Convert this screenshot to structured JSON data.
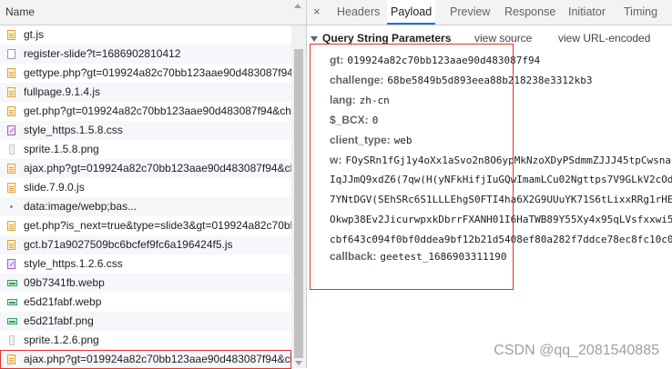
{
  "network": {
    "column_header": "Name",
    "rows": [
      {
        "name": "gt.js",
        "type": "js"
      },
      {
        "name": "register-slide?t=1686902810412",
        "type": "doc"
      },
      {
        "name": "gettype.php?gt=019924a82c70bb123aae90d483087f94&ca",
        "type": "js"
      },
      {
        "name": "fullpage.9.1.4.js",
        "type": "js"
      },
      {
        "name": "get.php?gt=019924a82c70bb123aae90d483087f94&challe",
        "type": "js"
      },
      {
        "name": "style_https.1.5.8.css",
        "type": "css"
      },
      {
        "name": "sprite.1.5.8.png",
        "type": "png"
      },
      {
        "name": "ajax.php?gt=019924a82c70bb123aae90d483087f94&chal",
        "type": "js"
      },
      {
        "name": "slide.7.9.0.js",
        "type": "js"
      },
      {
        "name": "data:image/webp;bas...",
        "type": "dot"
      },
      {
        "name": "get.php?is_next=true&type=slide3&gt=019924a82c70bb12",
        "type": "js"
      },
      {
        "name": "gct.b71a9027509bc6bcfef9fc6a196424f5.js",
        "type": "js"
      },
      {
        "name": "style_https.1.2.6.css",
        "type": "css"
      },
      {
        "name": "09b7341fb.webp",
        "type": "webp"
      },
      {
        "name": "e5d21fabf.webp",
        "type": "webp"
      },
      {
        "name": "e5d21fabf.png",
        "type": "webp"
      },
      {
        "name": "sprite.1.2.6.png",
        "type": "png"
      },
      {
        "name": "ajax.php?gt=019924a82c70bb123aae90d483087f94&chal",
        "type": "js",
        "selected": true
      }
    ]
  },
  "detail": {
    "close_symbol": "×",
    "tabs": [
      {
        "label": "Headers"
      },
      {
        "label": "Payload",
        "active": true
      },
      {
        "label": "Preview"
      },
      {
        "label": "Response"
      },
      {
        "label": "Initiator"
      },
      {
        "label": "Timing"
      }
    ],
    "section_title": "Query String Parameters",
    "view_source": "view source",
    "view_url_encoded": "view URL-encoded",
    "params": [
      {
        "key": "gt:",
        "value": "019924a82c70bb123aae90d483087f94"
      },
      {
        "key": "challenge:",
        "value": "68be5849b5d893eea88b218238e3312kb3"
      },
      {
        "key": "lang:",
        "value": "zh-cn"
      },
      {
        "key": "$_BCX:",
        "value": "0"
      },
      {
        "key": "client_type:",
        "value": "web"
      },
      {
        "key": "w:",
        "value": "FOySRn1fGj1y4oXx1aSvo2n8O6ypMkNzoXDyPSdmmZJJJ45tpCwsna"
      }
    ],
    "w_continuation": [
      "IqJJmQ9xdZ6(7qw(H(yNFkHifjIuGQwImamLCu02Ngttps7V9GLkV2cOd",
      "7YNtDGV(SEhSRc6S1LLLEhgS0FTI4ha6X2G9UUuYK71S6tLixxRRg1rHE",
      "Okwp38Ev2JicurwpxkDbrrFXANH01I6HaTWB89Y55Xy4x95qLVsfxxwi5",
      "cbf643c094f0bf0ddea9bf12b21d5408ef80a282f7ddce78ec8fc10c0"
    ],
    "callback": {
      "key": "callback:",
      "value": "geetest_1686903311190"
    }
  },
  "watermark": "CSDN @qq_2081540885",
  "colors": {
    "highlight": "#e2332b",
    "tab_accent": "#1a73e8"
  }
}
